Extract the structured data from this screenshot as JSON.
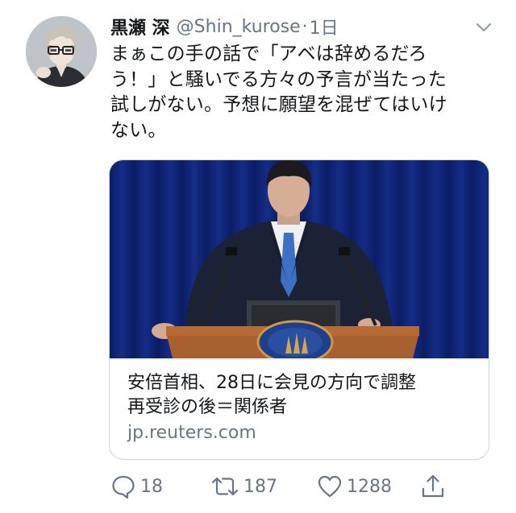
{
  "user": {
    "display_name": "黒瀬 深",
    "handle": "@Shin_kurose",
    "separator": "·",
    "time": "1日"
  },
  "tweet": {
    "text": "まぁこの手の話で「アベは辞めるだろう！」と騒いでる方々の予言が当たった試しがない。予想に願望を混ぜてはいけない。"
  },
  "card": {
    "title_line1": "安倍首相、28日に会見の方向で調整",
    "title_line2": "再受診の後＝関係者",
    "domain": "jp.reuters.com"
  },
  "actions": {
    "reply_count": "18",
    "retweet_count": "187",
    "like_count": "1288"
  },
  "icons": {
    "reply": "speech-bubble-icon",
    "retweet": "retweet-arrows-icon",
    "like": "heart-outline-icon",
    "share": "share-upload-icon",
    "menu": "chevron-down-icon"
  },
  "colors": {
    "text_primary": "#14171a",
    "text_secondary": "#657786",
    "card_border": "#ccd6dd"
  }
}
